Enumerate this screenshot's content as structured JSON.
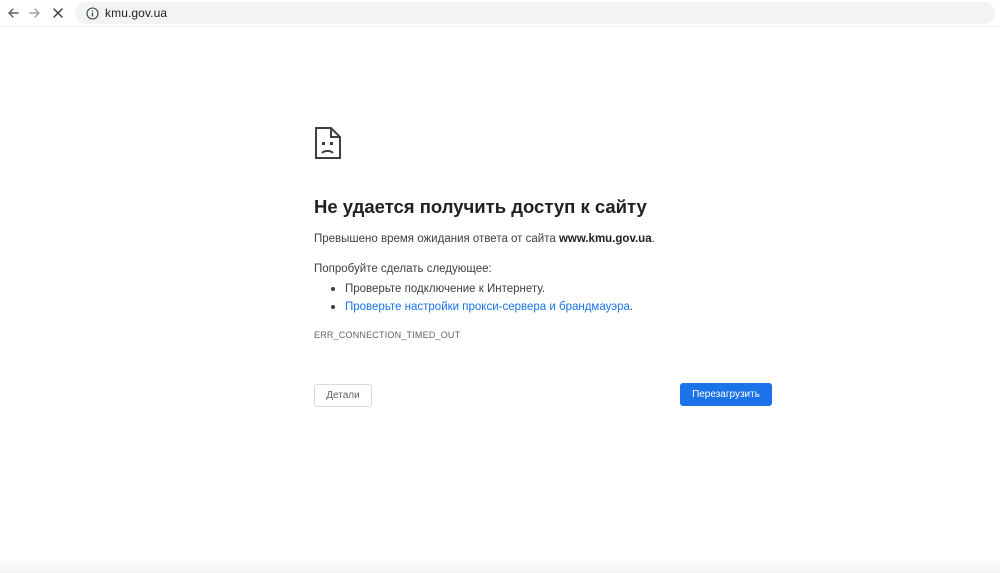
{
  "browser": {
    "url": "kmu.gov.ua",
    "icons": {
      "back": "arrow-left-icon",
      "forward": "arrow-right-icon",
      "stop": "close-icon",
      "site_info": "info-icon"
    }
  },
  "error_page": {
    "icon": "sad-page-icon",
    "title": "Не удается получить доступ к сайту",
    "summary_prefix": "Превышено время ожидания ответа от сайта ",
    "summary_host": "www.kmu.gov.ua",
    "summary_suffix": ".",
    "suggestions_heading": "Попробуйте сделать следующее:",
    "suggestions": [
      {
        "text": "Проверьте подключение к Интернету."
      },
      {
        "link_text": "Проверьте настройки прокси-сервера и брандмауэра",
        "suffix": "."
      }
    ],
    "error_code": "ERR_CONNECTION_TIMED_OUT",
    "details_button": "Детали",
    "reload_button": "Перезагрузить"
  },
  "colors": {
    "accent": "#1a73e8",
    "text": "#202124",
    "secondary_text": "#3c4043"
  }
}
